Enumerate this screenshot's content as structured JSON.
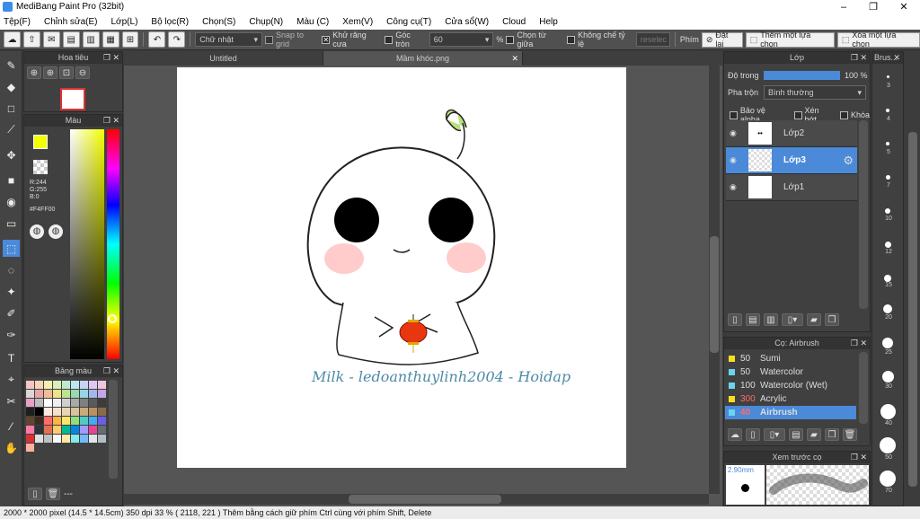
{
  "app": {
    "title": "MediBang Paint Pro (32bit)"
  },
  "menu": [
    "Tệp(F)",
    "Chỉnh sửa(E)",
    "Lớp(L)",
    "Bộ lọc(R)",
    "Chọn(S)",
    "Chụp(N)",
    "Màu (C)",
    "Xem(V)",
    "Công cụ(T)",
    "Cửa sổ(W)",
    "Cloud",
    "Help"
  ],
  "toolbar": {
    "shape_select": "Chữ nhật",
    "snap": "Snap to grid",
    "antialias": "Khử răng cưa",
    "round": "Góc tròn",
    "round_value": "60",
    "percent": "%",
    "center": "Chọn từ giữa",
    "no_ratio": "Không chế tỷ lệ",
    "ratio_field": "reselec",
    "phim": "Phím",
    "reset": "Đặt lại",
    "add_sel": "Thêm một lựa chọn",
    "del_sel": "Xóa một lựa chọn"
  },
  "navigator": {
    "title": "Hoa tiêu"
  },
  "color": {
    "title": "Màu",
    "r": "R:244",
    "g": "G:255",
    "b": "B:0",
    "hex": "#F4FF00",
    "fg": "#F4FF00"
  },
  "palette": {
    "title": "Bảng màu",
    "footer": "---",
    "colors": [
      "#f4c6c6",
      "#f7d6b8",
      "#f6efb5",
      "#d8f0b8",
      "#bfe9cf",
      "#bfe6ee",
      "#c7d4f2",
      "#dcc8f2",
      "#f1c4dd",
      "#d8d8d8",
      "#e9a6a6",
      "#efbe96",
      "#eee388",
      "#bde38e",
      "#98d9b0",
      "#98d4e1",
      "#a4b7ea",
      "#c5a4ea",
      "#e7a0c8",
      "#bcbcbc",
      "#ffffff",
      "#f0f0f0",
      "#cfcfcf",
      "#a9a9a9",
      "#7f7f7f",
      "#5a5a5a",
      "#3c3c3c",
      "#1f1f1f",
      "#000000",
      "#ffe7e0",
      "#f5e1c9",
      "#e8d5b5",
      "#d9c39b",
      "#c9ab7d",
      "#b99164",
      "#8a6a47",
      "#5e4630",
      "#3b2b1c",
      "#ff6b6b",
      "#ffb347",
      "#ffe36e",
      "#8ee07a",
      "#4ecdc4",
      "#45aaf2",
      "#6c5ce7",
      "#fd79a8",
      "#2d3436",
      "#e17055",
      "#fdcb6e",
      "#00b894",
      "#0984e3",
      "#a29bfe",
      "#e84393",
      "#636e72",
      "#d63031",
      "#e0e0e0",
      "#c0c0c0",
      "#fafafa",
      "#ffeaa7",
      "#81ecec",
      "#74b9ff",
      "#dfe6e9",
      "#b2bec3",
      "#fab1a0"
    ]
  },
  "canvas": {
    "tabs": [
      "Untitled",
      "Mầm khóc.png"
    ],
    "signature": "Milk - ledoanthuylinh2004 - Hoidap"
  },
  "layers": {
    "title": "Lớp",
    "opacity_label": "Độ trong",
    "opacity_value": "100 %",
    "opacity": 1.0,
    "blend_label": "Pha trộn",
    "blend_value": "Bình thường",
    "protect_alpha": "Bảo vệ alpha",
    "clipping": "Xén bớt",
    "lock": "Khóa",
    "items": [
      {
        "name": "Lớp2"
      },
      {
        "name": "Lớp3"
      },
      {
        "name": "Lớp1"
      }
    ]
  },
  "brush": {
    "title": "Cọ: Airbrush",
    "items": [
      {
        "size": "50",
        "name": "Sumi",
        "color": "#f4e020"
      },
      {
        "size": "50",
        "name": "Watercolor",
        "color": "#6ad4f0"
      },
      {
        "size": "100",
        "name": "Watercolor (Wet)",
        "color": "#6ad4f0"
      },
      {
        "size": "300",
        "name": "Acrylic",
        "color": "#f4e020"
      },
      {
        "size": "40",
        "name": "Airbrush",
        "color": "#6ad4f0"
      }
    ]
  },
  "preview": {
    "title": "Xem trước cọ",
    "size": "2.90mm"
  },
  "brushsize": {
    "title": "Brus...",
    "labels": [
      "3",
      "4",
      "5",
      "7",
      "10",
      "12",
      "15",
      "20",
      "25",
      "30",
      "40",
      "50",
      "70"
    ]
  },
  "status": {
    "text": "2000 * 2000 pixel   (14.5 * 14.5cm)   350 dpi   33 %   ( 2118, 221 )   Thêm bằng cách giữ phím Ctrl cùng với phím Shift, Delete"
  }
}
